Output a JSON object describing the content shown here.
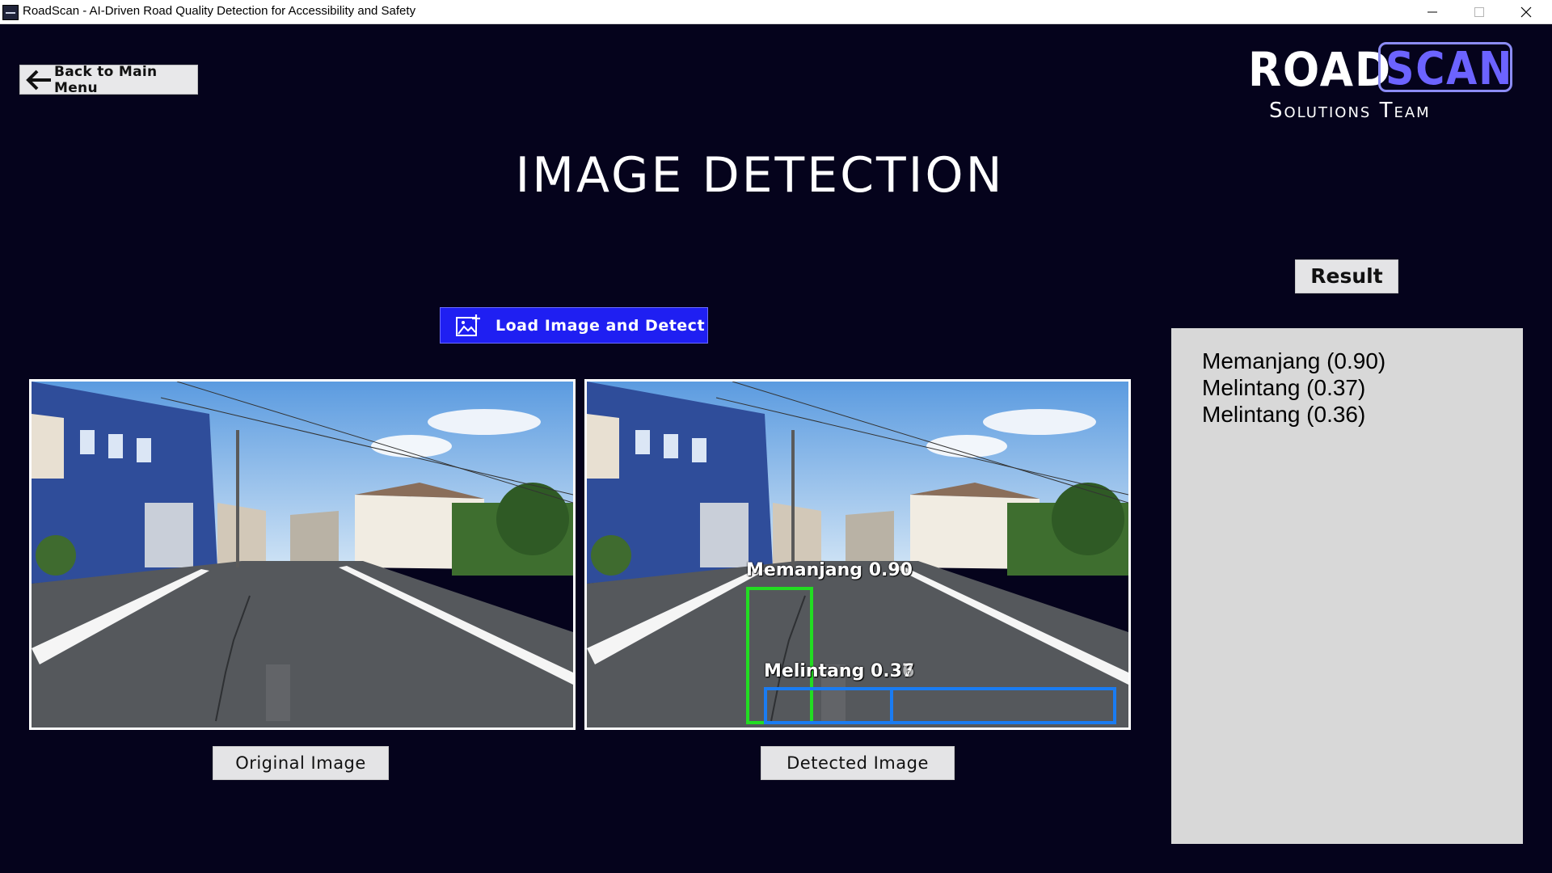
{
  "window": {
    "title": "RoadScan - AI-Driven Road Quality Detection for Accessibility and Safety"
  },
  "nav": {
    "back_label": "Back to Main Menu"
  },
  "logo": {
    "word1": "ROAD",
    "word2": "SCAN",
    "subtitle": "Solutions Team"
  },
  "page": {
    "title": "IMAGE DETECTION"
  },
  "actions": {
    "load_label": "Load Image and Detect"
  },
  "images": {
    "original_caption": "Original Image",
    "detected_caption": "Detected Image"
  },
  "detections": [
    {
      "label": "Memanjang 0.90",
      "class": "Memanjang",
      "score": 0.9,
      "color": "#22dd22"
    },
    {
      "label": "Melintang 0.37",
      "class": "Melintang",
      "score": 0.37,
      "color": "#1a7cf2"
    },
    {
      "label": "Melintang 0.36",
      "class": "Melintang",
      "score": 0.36,
      "color": "#1a7cf2"
    }
  ],
  "result": {
    "title": "Result",
    "items": [
      "Memanjang (0.90)",
      "Melintang (0.37)",
      "Melintang (0.36)"
    ]
  },
  "colors": {
    "background": "#05031c",
    "accent_button": "#1f1ff2",
    "logo_accent": "#6c63ff",
    "panel": "#d8d8d8"
  }
}
